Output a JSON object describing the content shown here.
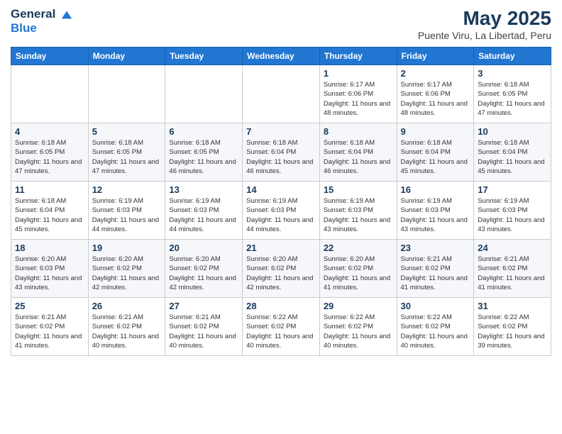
{
  "logo": {
    "line1": "General",
    "line2": "Blue"
  },
  "title": "May 2025",
  "subtitle": "Puente Viru, La Libertad, Peru",
  "days_header": [
    "Sunday",
    "Monday",
    "Tuesday",
    "Wednesday",
    "Thursday",
    "Friday",
    "Saturday"
  ],
  "weeks": [
    [
      {
        "day": "",
        "info": ""
      },
      {
        "day": "",
        "info": ""
      },
      {
        "day": "",
        "info": ""
      },
      {
        "day": "",
        "info": ""
      },
      {
        "day": "1",
        "info": "Sunrise: 6:17 AM\nSunset: 6:06 PM\nDaylight: 11 hours and 48 minutes."
      },
      {
        "day": "2",
        "info": "Sunrise: 6:17 AM\nSunset: 6:06 PM\nDaylight: 11 hours and 48 minutes."
      },
      {
        "day": "3",
        "info": "Sunrise: 6:18 AM\nSunset: 6:05 PM\nDaylight: 11 hours and 47 minutes."
      }
    ],
    [
      {
        "day": "4",
        "info": "Sunrise: 6:18 AM\nSunset: 6:05 PM\nDaylight: 11 hours and 47 minutes."
      },
      {
        "day": "5",
        "info": "Sunrise: 6:18 AM\nSunset: 6:05 PM\nDaylight: 11 hours and 47 minutes."
      },
      {
        "day": "6",
        "info": "Sunrise: 6:18 AM\nSunset: 6:05 PM\nDaylight: 11 hours and 46 minutes."
      },
      {
        "day": "7",
        "info": "Sunrise: 6:18 AM\nSunset: 6:04 PM\nDaylight: 11 hours and 46 minutes."
      },
      {
        "day": "8",
        "info": "Sunrise: 6:18 AM\nSunset: 6:04 PM\nDaylight: 11 hours and 46 minutes."
      },
      {
        "day": "9",
        "info": "Sunrise: 6:18 AM\nSunset: 6:04 PM\nDaylight: 11 hours and 45 minutes."
      },
      {
        "day": "10",
        "info": "Sunrise: 6:18 AM\nSunset: 6:04 PM\nDaylight: 11 hours and 45 minutes."
      }
    ],
    [
      {
        "day": "11",
        "info": "Sunrise: 6:18 AM\nSunset: 6:04 PM\nDaylight: 11 hours and 45 minutes."
      },
      {
        "day": "12",
        "info": "Sunrise: 6:19 AM\nSunset: 6:03 PM\nDaylight: 11 hours and 44 minutes."
      },
      {
        "day": "13",
        "info": "Sunrise: 6:19 AM\nSunset: 6:03 PM\nDaylight: 11 hours and 44 minutes."
      },
      {
        "day": "14",
        "info": "Sunrise: 6:19 AM\nSunset: 6:03 PM\nDaylight: 11 hours and 44 minutes."
      },
      {
        "day": "15",
        "info": "Sunrise: 6:19 AM\nSunset: 6:03 PM\nDaylight: 11 hours and 43 minutes."
      },
      {
        "day": "16",
        "info": "Sunrise: 6:19 AM\nSunset: 6:03 PM\nDaylight: 11 hours and 43 minutes."
      },
      {
        "day": "17",
        "info": "Sunrise: 6:19 AM\nSunset: 6:03 PM\nDaylight: 11 hours and 43 minutes."
      }
    ],
    [
      {
        "day": "18",
        "info": "Sunrise: 6:20 AM\nSunset: 6:03 PM\nDaylight: 11 hours and 43 minutes."
      },
      {
        "day": "19",
        "info": "Sunrise: 6:20 AM\nSunset: 6:02 PM\nDaylight: 11 hours and 42 minutes."
      },
      {
        "day": "20",
        "info": "Sunrise: 6:20 AM\nSunset: 6:02 PM\nDaylight: 11 hours and 42 minutes."
      },
      {
        "day": "21",
        "info": "Sunrise: 6:20 AM\nSunset: 6:02 PM\nDaylight: 11 hours and 42 minutes."
      },
      {
        "day": "22",
        "info": "Sunrise: 6:20 AM\nSunset: 6:02 PM\nDaylight: 11 hours and 41 minutes."
      },
      {
        "day": "23",
        "info": "Sunrise: 6:21 AM\nSunset: 6:02 PM\nDaylight: 11 hours and 41 minutes."
      },
      {
        "day": "24",
        "info": "Sunrise: 6:21 AM\nSunset: 6:02 PM\nDaylight: 11 hours and 41 minutes."
      }
    ],
    [
      {
        "day": "25",
        "info": "Sunrise: 6:21 AM\nSunset: 6:02 PM\nDaylight: 11 hours and 41 minutes."
      },
      {
        "day": "26",
        "info": "Sunrise: 6:21 AM\nSunset: 6:02 PM\nDaylight: 11 hours and 40 minutes."
      },
      {
        "day": "27",
        "info": "Sunrise: 6:21 AM\nSunset: 6:02 PM\nDaylight: 11 hours and 40 minutes."
      },
      {
        "day": "28",
        "info": "Sunrise: 6:22 AM\nSunset: 6:02 PM\nDaylight: 11 hours and 40 minutes."
      },
      {
        "day": "29",
        "info": "Sunrise: 6:22 AM\nSunset: 6:02 PM\nDaylight: 11 hours and 40 minutes."
      },
      {
        "day": "30",
        "info": "Sunrise: 6:22 AM\nSunset: 6:02 PM\nDaylight: 11 hours and 40 minutes."
      },
      {
        "day": "31",
        "info": "Sunrise: 6:22 AM\nSunset: 6:02 PM\nDaylight: 11 hours and 39 minutes."
      }
    ]
  ]
}
